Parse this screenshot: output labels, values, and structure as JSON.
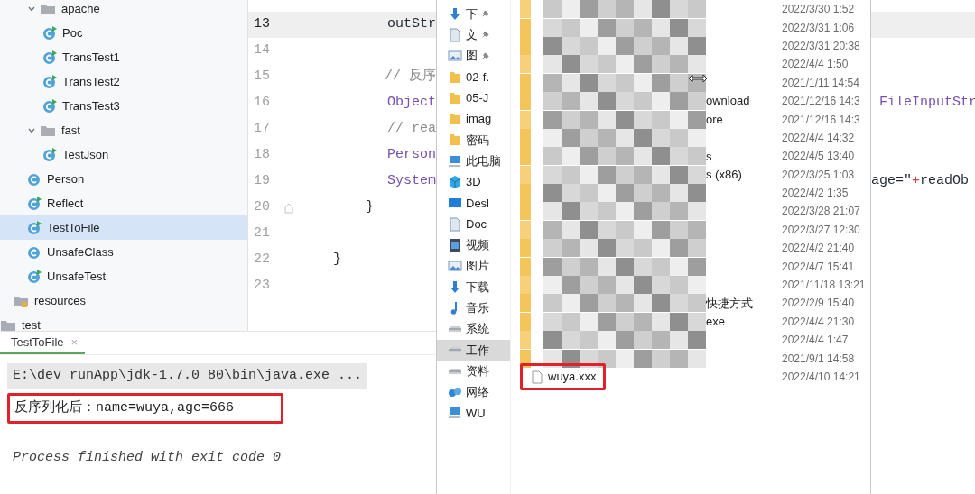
{
  "project_tree": [
    {
      "label": "apache",
      "kind": "folder",
      "expanded": true,
      "selected": false,
      "children": [
        {
          "label": "Poc",
          "kind": "runnable",
          "selected": false
        },
        {
          "label": "TransTest1",
          "kind": "runnable",
          "selected": false
        },
        {
          "label": "TransTest2",
          "kind": "runnable",
          "selected": false
        },
        {
          "label": "TransTest3",
          "kind": "runnable",
          "selected": false
        }
      ]
    },
    {
      "label": "fast",
      "kind": "folder",
      "expanded": true,
      "selected": false,
      "children": [
        {
          "label": "TestJson",
          "kind": "runnable",
          "selected": false
        }
      ]
    },
    {
      "label": "Person",
      "kind": "class",
      "selected": false
    },
    {
      "label": "Reflect",
      "kind": "runnable",
      "selected": false
    },
    {
      "label": "TestToFile",
      "kind": "runnable",
      "selected": true
    },
    {
      "label": "UnsafeClass",
      "kind": "class",
      "selected": false
    },
    {
      "label": "UnsafeTest",
      "kind": "runnable",
      "selected": false
    },
    {
      "label": "resources",
      "kind": "resources",
      "selected": false
    },
    {
      "label": "test",
      "kind": "folder_root",
      "selected": false
    }
  ],
  "editor": {
    "lines": [
      {
        "number": "13",
        "current": true,
        "tokens": [
          {
            "text": "            outStr",
            "kind": "code"
          }
        ]
      },
      {
        "number": "14",
        "current": false
      },
      {
        "number": "15",
        "current": false,
        "tokens": [
          {
            "text": "            // 反序",
            "kind": "comment"
          }
        ]
      },
      {
        "number": "16",
        "current": false,
        "tokens": [
          {
            "text": "            Object",
            "kind": "type"
          }
        ],
        "right": [
          {
            "text": " FileInputStr",
            "kind": "type"
          }
        ]
      },
      {
        "number": "17",
        "current": false,
        "tokens": [
          {
            "text": "            // rea",
            "kind": "comment"
          }
        ]
      },
      {
        "number": "18",
        "current": false,
        "tokens": [
          {
            "text": "            Person",
            "kind": "type"
          }
        ]
      },
      {
        "number": "19",
        "current": false,
        "tokens": [
          {
            "text": "            System",
            "kind": "type"
          }
        ],
        "right": [
          {
            "text": "age=\"",
            "kind": "code"
          },
          {
            "text": "+",
            "kind": "operator"
          },
          {
            "text": "readOb",
            "kind": "code"
          }
        ]
      },
      {
        "number": "20",
        "current": false,
        "fold": true,
        "tokens": [
          {
            "text": "        }",
            "kind": "code"
          }
        ]
      },
      {
        "number": "21",
        "current": false
      },
      {
        "number": "22",
        "current": false,
        "tokens": [
          {
            "text": "    }",
            "kind": "code"
          }
        ]
      },
      {
        "number": "23",
        "current": false
      }
    ]
  },
  "run_panel": {
    "tab": {
      "label": "TestToFile",
      "close": "×",
      "selected": true
    },
    "lines": [
      {
        "text": "E:\\dev_runApp\\jdk-1.7.0_80\\bin\\java.exe ...",
        "kind": "command",
        "highlighted": false
      },
      {
        "text": "反序列化后：name=wuya,age=666",
        "kind": "output",
        "highlighted": true
      },
      {
        "text": "Process finished with exit code 0",
        "kind": "status",
        "highlighted": false
      }
    ]
  },
  "explorer": {
    "nav": [
      {
        "label": "下",
        "kind": "download",
        "pinned": true,
        "selected": false
      },
      {
        "label": "文",
        "kind": "document",
        "pinned": true,
        "selected": false
      },
      {
        "label": "图",
        "kind": "picture",
        "pinned": true,
        "selected": false
      },
      {
        "label": "02-f.",
        "kind": "folder",
        "pinned": false,
        "selected": false
      },
      {
        "label": "05-J",
        "kind": "folder",
        "pinned": false,
        "selected": false
      },
      {
        "label": "imag",
        "kind": "folder",
        "pinned": false,
        "selected": false
      },
      {
        "label": "密码",
        "kind": "folder",
        "pinned": false,
        "selected": false
      },
      {
        "label": "此电脑",
        "kind": "computer",
        "pinned": false,
        "selected": false
      },
      {
        "label": "3D",
        "kind": "cube",
        "pinned": false,
        "selected": false
      },
      {
        "label": "Desl",
        "kind": "desktop",
        "pinned": false,
        "selected": false
      },
      {
        "label": "Doc",
        "kind": "document",
        "pinned": false,
        "selected": false
      },
      {
        "label": "视频",
        "kind": "video",
        "pinned": false,
        "selected": false
      },
      {
        "label": "图片",
        "kind": "picture",
        "pinned": false,
        "selected": false
      },
      {
        "label": "下载",
        "kind": "download",
        "pinned": false,
        "selected": false
      },
      {
        "label": "音乐",
        "kind": "music",
        "pinned": false,
        "selected": false
      },
      {
        "label": "系统",
        "kind": "drive",
        "pinned": false,
        "selected": false
      },
      {
        "label": "工作",
        "kind": "drive",
        "pinned": false,
        "selected": true
      },
      {
        "label": "资料",
        "kind": "drive",
        "pinned": false,
        "selected": false
      },
      {
        "label": "网络",
        "kind": "network",
        "pinned": false,
        "selected": false
      },
      {
        "label": "WU",
        "kind": "computer",
        "pinned": false,
        "selected": false
      }
    ],
    "files": [
      {
        "kind": "blurred",
        "date": "2022/3/30 1:52"
      },
      {
        "kind": "blurred",
        "date": "2022/3/31 1:06"
      },
      {
        "kind": "blurred",
        "date": "2022/3/31 20:38"
      },
      {
        "kind": "blurred",
        "date": "2022/4/4 1:50"
      },
      {
        "kind": "blurred",
        "date": "2021/1/11 14:54"
      },
      {
        "kind": "blurred",
        "name": "ownload",
        "date": "2021/12/16 14:3"
      },
      {
        "kind": "blurred",
        "name": "ore",
        "date": "2021/12/16 14:3"
      },
      {
        "kind": "blurred",
        "date": "2022/4/4 14:32"
      },
      {
        "kind": "blurred",
        "name": "s",
        "date": "2022/4/5 13:40"
      },
      {
        "kind": "blurred",
        "name": "s (x86)",
        "date": "2022/3/25 1:03"
      },
      {
        "kind": "blurred",
        "date": "2022/4/2 1:35"
      },
      {
        "kind": "blurred",
        "date": "2022/3/28 21:07"
      },
      {
        "kind": "blurred",
        "date": "2022/3/27 12:30"
      },
      {
        "kind": "blurred",
        "date": "2022/4/2 21:40"
      },
      {
        "kind": "blurred",
        "date": "2022/4/7 15:41"
      },
      {
        "kind": "blurred",
        "date": "2021/11/18 13:21"
      },
      {
        "kind": "blurred",
        "name": "快捷方式",
        "date": "2022/2/9 15:40"
      },
      {
        "kind": "blurred",
        "name": "exe",
        "date": "2022/4/4 21:30"
      },
      {
        "kind": "blurred",
        "date": "2022/4/4 1:47"
      },
      {
        "kind": "blurred",
        "date": "2021/9/1 14:58"
      },
      {
        "kind": "file",
        "name": "wuya.xxx",
        "highlighted": true,
        "date": "2022/4/10 14:21"
      }
    ]
  }
}
